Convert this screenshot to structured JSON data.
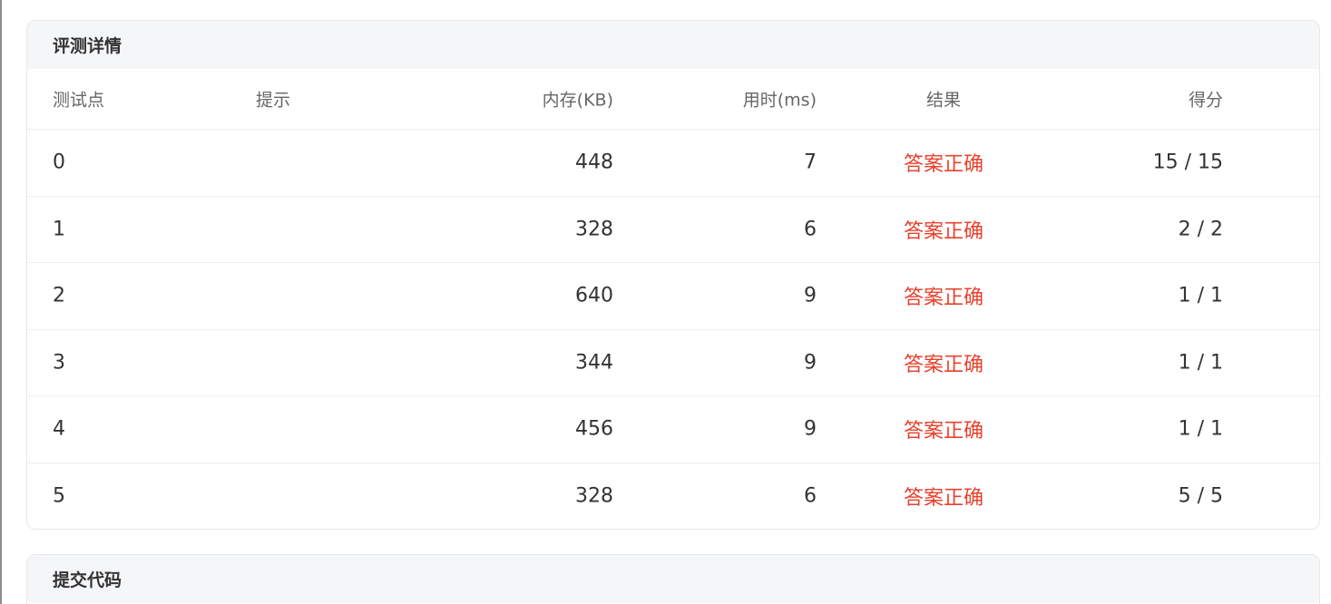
{
  "details": {
    "title": "评测详情",
    "columns": {
      "id": "测试点",
      "hint": "提示",
      "memory": "内存(KB)",
      "time": "用时(ms)",
      "result": "结果",
      "score": "得分"
    },
    "rows": [
      {
        "id": "0",
        "hint": "",
        "memory": "448",
        "time": "7",
        "result": "答案正确",
        "score": "15 / 15"
      },
      {
        "id": "1",
        "hint": "",
        "memory": "328",
        "time": "6",
        "result": "答案正确",
        "score": "2 / 2"
      },
      {
        "id": "2",
        "hint": "",
        "memory": "640",
        "time": "9",
        "result": "答案正确",
        "score": "1 / 1"
      },
      {
        "id": "3",
        "hint": "",
        "memory": "344",
        "time": "9",
        "result": "答案正确",
        "score": "1 / 1"
      },
      {
        "id": "4",
        "hint": "",
        "memory": "456",
        "time": "9",
        "result": "答案正确",
        "score": "1 / 1"
      },
      {
        "id": "5",
        "hint": "",
        "memory": "328",
        "time": "6",
        "result": "答案正确",
        "score": "5 / 5"
      }
    ]
  },
  "code": {
    "title": "提交代码"
  },
  "colors": {
    "accepted": "#e8412d",
    "header_bg": "#f5f6f8"
  }
}
